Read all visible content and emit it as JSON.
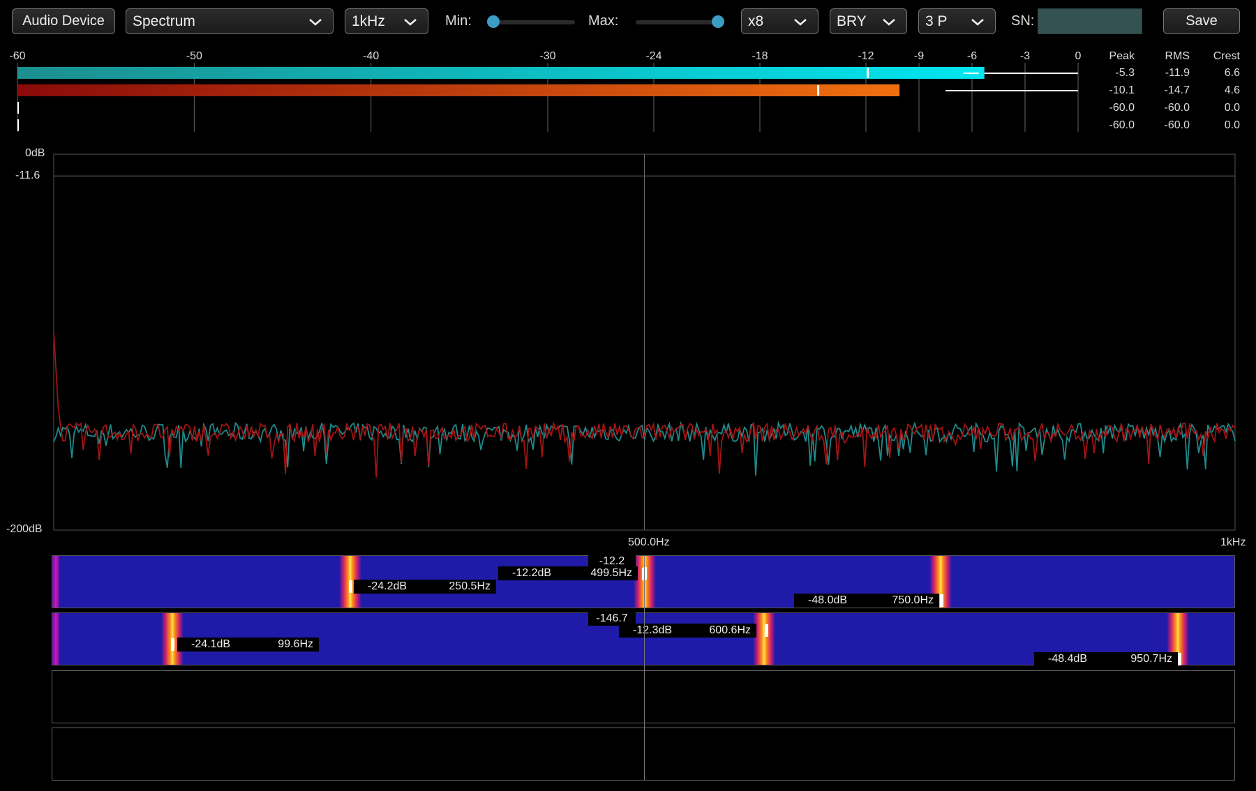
{
  "toolbar": {
    "audio_device_label": "Audio Device",
    "view_select": "Spectrum",
    "range_select": "1kHz",
    "min_label": "Min:",
    "max_label": "Max:",
    "min_value": 0,
    "max_value": 1,
    "zoom_select": "x8",
    "palette_select": "BRY",
    "peaks_select": "3 P",
    "sn_label": "SN:",
    "sn_value": "",
    "save_label": "Save"
  },
  "level_meter": {
    "scale_ticks": [
      "-60",
      "-50",
      "-40",
      "-30",
      "-24",
      "-18",
      "-12",
      "-9",
      "-6",
      "-3",
      "0"
    ],
    "scale_values": [
      -60,
      -50,
      -40,
      -30,
      -24,
      -18,
      -12,
      -9,
      -6,
      -3,
      0
    ],
    "columns": {
      "peak": "Peak",
      "rms": "RMS",
      "crest": "Crest"
    },
    "channels": [
      {
        "peak": "-5.3",
        "rms": "-11.9",
        "crest": "6.6",
        "level_db": -5.3,
        "rms_db": -11.9,
        "color": "#00d8e6"
      },
      {
        "peak": "-10.1",
        "rms": "-14.7",
        "crest": "4.6",
        "level_db": -10.1,
        "rms_db": -14.7,
        "color": "#e86a10"
      },
      {
        "peak": "-60.0",
        "rms": "-60.0",
        "crest": "0.0",
        "level_db": -60.0,
        "rms_db": -60.0
      },
      {
        "peak": "-60.0",
        "rms": "-60.0",
        "crest": "0.0",
        "level_db": -60.0,
        "rms_db": -60.0
      }
    ]
  },
  "chart_data": {
    "type": "line",
    "y_top_label": "0dB",
    "y_ref_label": "-11.6",
    "y_bottom_label": "-200dB",
    "x_mid_label": "500.0Hz",
    "x_max_label": "1kHz",
    "xlim": [
      0,
      1000
    ],
    "ylim": [
      -200,
      0
    ],
    "series": [
      {
        "color": "#1f8a8c",
        "peaks": [
          {
            "x": 250.5,
            "y": -24.2
          },
          {
            "x": 499.5,
            "y": -12.2
          },
          {
            "x": 750.0,
            "y": -48.0
          }
        ]
      },
      {
        "color": "#a31414",
        "peaks": [
          {
            "x": 99.6,
            "y": -24.1
          },
          {
            "x": 600.6,
            "y": -12.3
          },
          {
            "x": 950.7,
            "y": -48.4
          }
        ]
      }
    ]
  },
  "waterfalls": [
    {
      "cursor_value": "-12.2",
      "peaks": [
        {
          "db": "-24.2dB",
          "hz": "250.5Hz",
          "freq": 250.5
        },
        {
          "db": "-12.2dB",
          "hz": "499.5Hz",
          "freq": 499.5
        },
        {
          "db": "-48.0dB",
          "hz": "750.0Hz",
          "freq": 750.0
        }
      ]
    },
    {
      "cursor_value": "-146.7",
      "peaks": [
        {
          "db": "-24.1dB",
          "hz": "99.6Hz",
          "freq": 99.6
        },
        {
          "db": "-12.3dB",
          "hz": "600.6Hz",
          "freq": 600.6
        },
        {
          "db": "-48.4dB",
          "hz": "950.7Hz",
          "freq": 950.7
        }
      ]
    }
  ]
}
